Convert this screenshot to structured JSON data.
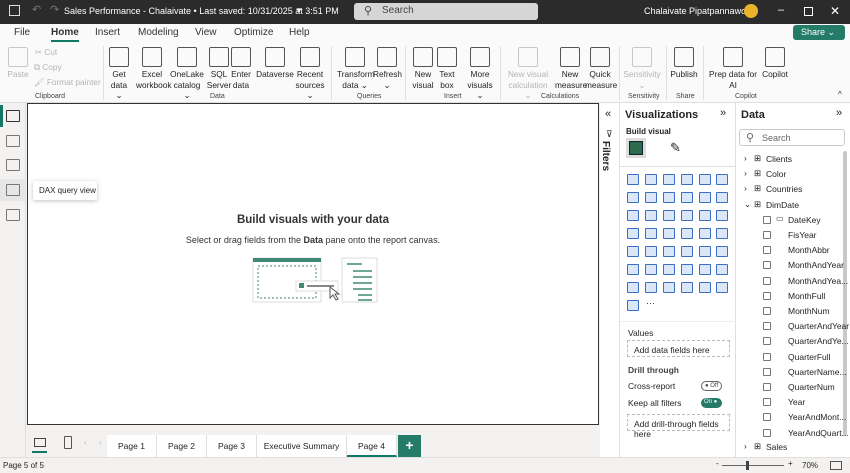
{
  "titlebar": {
    "title": "Sales Performance - Chalaivate • Last saved: 10/31/2025 at 3:51 PM",
    "search_placeholder": "Search",
    "user": "Chalaivate Pipatpannawong"
  },
  "tabs": [
    "File",
    "Home",
    "Insert",
    "Modeling",
    "View",
    "Optimize",
    "Help"
  ],
  "active_tab": "Home",
  "share_label": "Share",
  "ribbon": {
    "clipboard": {
      "paste": "Paste",
      "cut": "Cut",
      "copy": "Copy",
      "format_painter": "Format painter",
      "group": "Clipboard"
    },
    "data": {
      "buttons": [
        [
          "Get",
          "data ⌄"
        ],
        [
          "Excel",
          "workbook"
        ],
        [
          "OneLake",
          "catalog ⌄"
        ],
        [
          "SQL",
          "Server"
        ],
        [
          "Enter",
          "data"
        ],
        [
          "Dataverse",
          ""
        ],
        [
          "Recent",
          "sources ⌄"
        ]
      ],
      "group": "Data"
    },
    "queries": {
      "buttons": [
        [
          "Transform",
          "data ⌄"
        ],
        [
          "Refresh",
          "⌄"
        ]
      ],
      "group": "Queries"
    },
    "insert": {
      "buttons": [
        [
          "New",
          "visual"
        ],
        [
          "Text",
          "box"
        ],
        [
          "More",
          "visuals ⌄"
        ]
      ],
      "group": "Insert"
    },
    "calculations": {
      "buttons": [
        [
          "New visual",
          "calculation ⌄"
        ],
        [
          "New",
          "measure"
        ],
        [
          "Quick",
          "measure"
        ]
      ],
      "group": "Calculations"
    },
    "sensitivity": {
      "buttons": [
        [
          "Sensitivity",
          "⌄"
        ]
      ],
      "group": "Sensitivity"
    },
    "share": {
      "buttons": [
        [
          "Publish",
          ""
        ]
      ],
      "group": "Share"
    },
    "copilot": {
      "buttons": [
        [
          "Prep data for",
          "AI"
        ],
        [
          "Copilot",
          ""
        ]
      ],
      "group": "Copilot"
    }
  },
  "leftnav": {
    "items": [
      "report-view",
      "table-view",
      "model-view",
      "dax-query-view",
      "tmdl-view"
    ],
    "tooltip": "DAX query view"
  },
  "canvas": {
    "heading": "Build visuals with your data",
    "sub_pre": "Select or drag fields from the ",
    "sub_bold": "Data",
    "sub_post": " pane onto the report canvas."
  },
  "filters_label": "Filters",
  "visualizations": {
    "title": "Visualizations",
    "build_visual": "Build visual",
    "values_label": "Values",
    "values_placeholder": "Add data fields here",
    "drill_through": "Drill through",
    "cross_report": "Cross-report",
    "cross_report_state": "Off",
    "keep_all_filters": "Keep all filters",
    "keep_all_filters_state": "On",
    "drill_placeholder": "Add drill-through fields here",
    "more": "···"
  },
  "data_pane": {
    "title": "Data",
    "search_placeholder": "Search",
    "tables": [
      {
        "name": "Clients",
        "expanded": false
      },
      {
        "name": "Color",
        "expanded": false
      },
      {
        "name": "Countries",
        "expanded": false
      },
      {
        "name": "DimDate",
        "expanded": true
      }
    ],
    "fields": [
      "DateKey",
      "FisYear",
      "MonthAbbr",
      "MonthAndYear",
      "MonthAndYea...",
      "MonthFull",
      "MonthNum",
      "QuarterAndYear",
      "QuarterAndYe...",
      "QuarterFull",
      "QuarterName...",
      "QuarterNum",
      "Year",
      "YearAndMont...",
      "YearAndQuart..."
    ],
    "last_table": "Sales"
  },
  "pages": {
    "tabs": [
      "Page 1",
      "Page 2",
      "Page 3",
      "Executive Summary",
      "Page 4"
    ],
    "active": "Page 4",
    "add": "+"
  },
  "status": {
    "page": "Page 5 of 5",
    "zoom": "70%",
    "zoom_level": 70
  },
  "colors": {
    "accent": "#117865",
    "share": "#237b68",
    "titlebar": "#2b2b2b"
  }
}
